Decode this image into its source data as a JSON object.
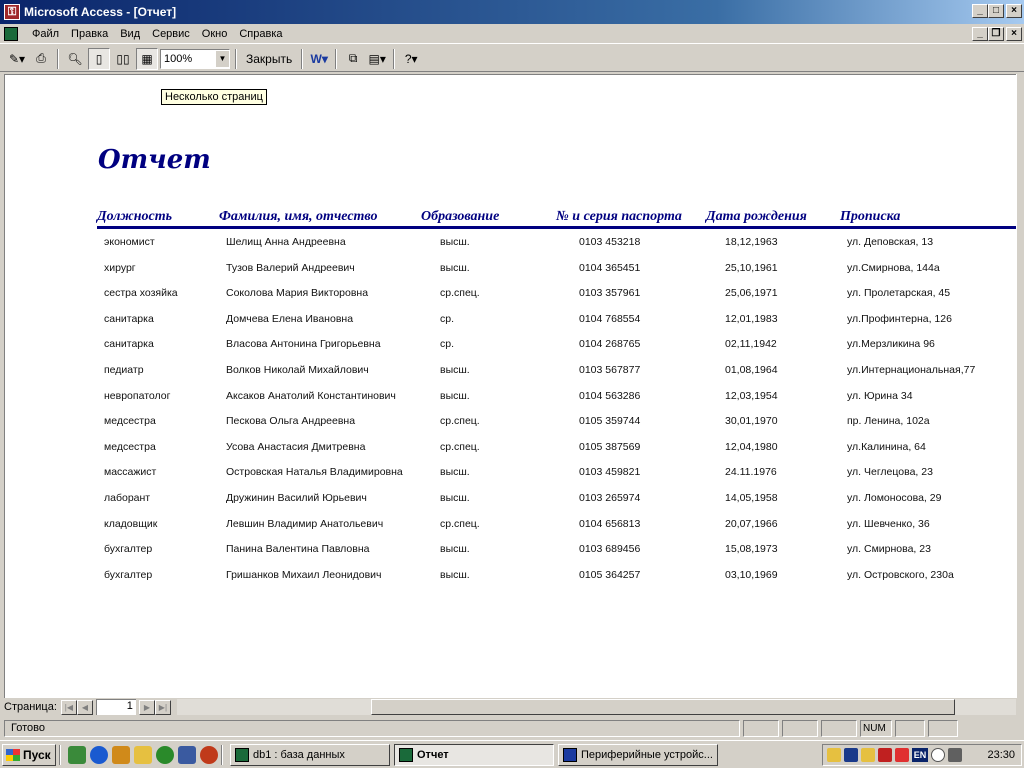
{
  "window": {
    "title": "Microsoft Access - [Отчет]"
  },
  "menu": [
    {
      "label": "Файл"
    },
    {
      "label": "Правка"
    },
    {
      "label": "Вид"
    },
    {
      "label": "Сервис"
    },
    {
      "label": "Окно"
    },
    {
      "label": "Справка"
    }
  ],
  "toolbar": {
    "zoom_value": "100%",
    "close_label": "Закрыть",
    "tooltip": "Несколько страниц"
  },
  "report": {
    "title": "Отчет",
    "columns": [
      "Должность",
      "Фамилия, имя, отчество",
      "Образование",
      "№ и серия паспорта",
      "Дата рождения",
      "Прописка"
    ],
    "rows": [
      [
        "экономист",
        "Шелищ Анна Андреевна",
        "высш.",
        "0103 453218",
        "18,12,1963",
        "ул. Деповская, 13"
      ],
      [
        "хирург",
        "Тузов Валерий Андреевич",
        "высш.",
        "0104 365451",
        "25,10,1961",
        "ул.Смирнова, 144а"
      ],
      [
        "сестра хозяйка",
        "Соколова Мария Викторовна",
        "ср.спец.",
        "0103 357961",
        "25,06,1971",
        "ул. Пролетарская, 45"
      ],
      [
        "санитарка",
        "Домчева Елена Ивановна",
        "ср.",
        "0104 768554",
        "12,01,1983",
        "ул.Профинтерна, 126"
      ],
      [
        "санитарка",
        "Власова Антонина Григорьевна",
        "ср.",
        "0104 268765",
        "02,11,1942",
        "ул.Мерзликина 96"
      ],
      [
        "педиатр",
        "Волков Николай Михайлович",
        "высш.",
        "0103 567877",
        "01,08,1964",
        "ул.Интернациональная,77"
      ],
      [
        "невропатолог",
        "Аксаков Анатолий Константинович",
        "высш.",
        "0104 563286",
        "12,03,1954",
        "ул. Юрина 34"
      ],
      [
        "медсестра",
        "Пескова Ольга Андреевна",
        "ср.спец.",
        "0105 359744",
        "30,01,1970",
        "пр. Ленина, 102а"
      ],
      [
        "медсестра",
        "Усова Анастасия Дмитревна",
        "ср.спец.",
        "0105 387569",
        "12,04,1980",
        "ул.Калинина, 64"
      ],
      [
        "массажист",
        "Островская Наталья Владимировна",
        "высш.",
        "0103 459821",
        "24.11.1976",
        "ул. Чеглецова, 23"
      ],
      [
        "лаборант",
        "Дружинин Василий Юрьевич",
        "высш.",
        "0103 265974",
        "14,05,1958",
        "ул. Ломоносова, 29"
      ],
      [
        "кладовщик",
        "Левшин Владимир Анатольевич",
        "ср.спец.",
        "0104 656813",
        "20,07,1966",
        "ул. Шевченко, 36"
      ],
      [
        "бухгалтер",
        "Панина Валентина Павловна",
        "высш.",
        "0103 689456",
        "15,08,1973",
        "ул. Смирнова, 23"
      ],
      [
        "бухгалтер",
        "Гришанков Михаил Леонидович",
        "высш.",
        "0105 364257",
        "03,10,1969",
        "ул. Островского, 230а"
      ]
    ]
  },
  "navigation": {
    "page_label": "Страница:",
    "page_number": "1"
  },
  "status": {
    "text": "Готово",
    "num": "NUM"
  },
  "taskbar": {
    "start_label": "Пуск",
    "tasks": [
      {
        "label": "db1 : база данных"
      },
      {
        "label": "Отчет"
      },
      {
        "label": "Периферийные устройс..."
      }
    ],
    "lang": "EN",
    "clock": "23:30"
  }
}
